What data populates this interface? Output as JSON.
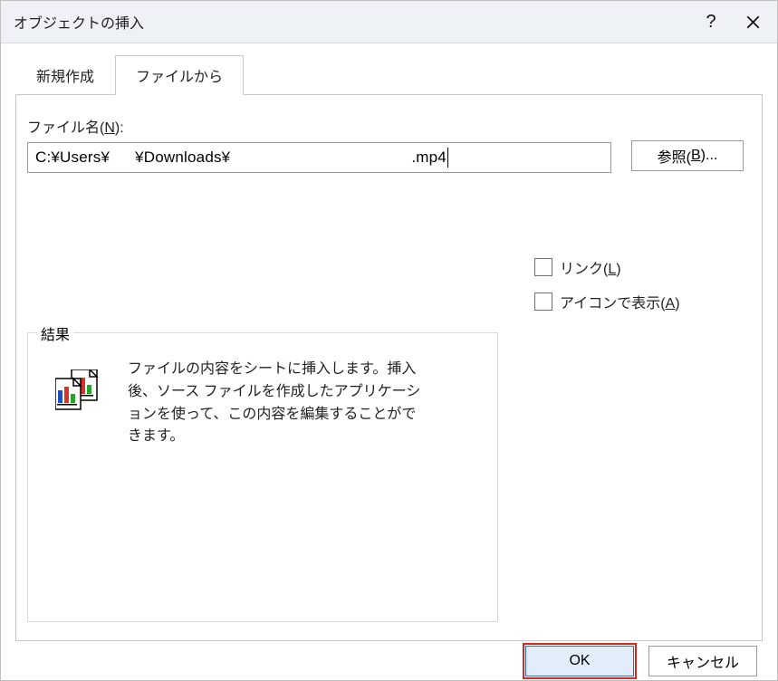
{
  "title": "オブジェクトの挿入",
  "tabs": {
    "new": "新規作成",
    "from_file": "ファイルから"
  },
  "filename": {
    "label_prefix": "ファイル名(",
    "label_accel": "N",
    "label_suffix": "):",
    "value_head": "C:¥Users¥",
    "value_mid": "¥Downloads¥",
    "value_tail": ".mp4"
  },
  "browse": {
    "prefix": "参照(",
    "accel": "B",
    "suffix": ")..."
  },
  "options": {
    "link": {
      "prefix": "リンク(",
      "accel": "L",
      "suffix": ")"
    },
    "icon": {
      "prefix": "アイコンで表示(",
      "accel": "A",
      "suffix": ")"
    }
  },
  "group": {
    "title": "結果",
    "text": "ファイルの内容をシートに挿入します。挿入後、ソース ファイルを作成したアプリケーションを使って、この内容を編集することができます。"
  },
  "footer": {
    "ok": "OK",
    "cancel": "キャンセル"
  }
}
